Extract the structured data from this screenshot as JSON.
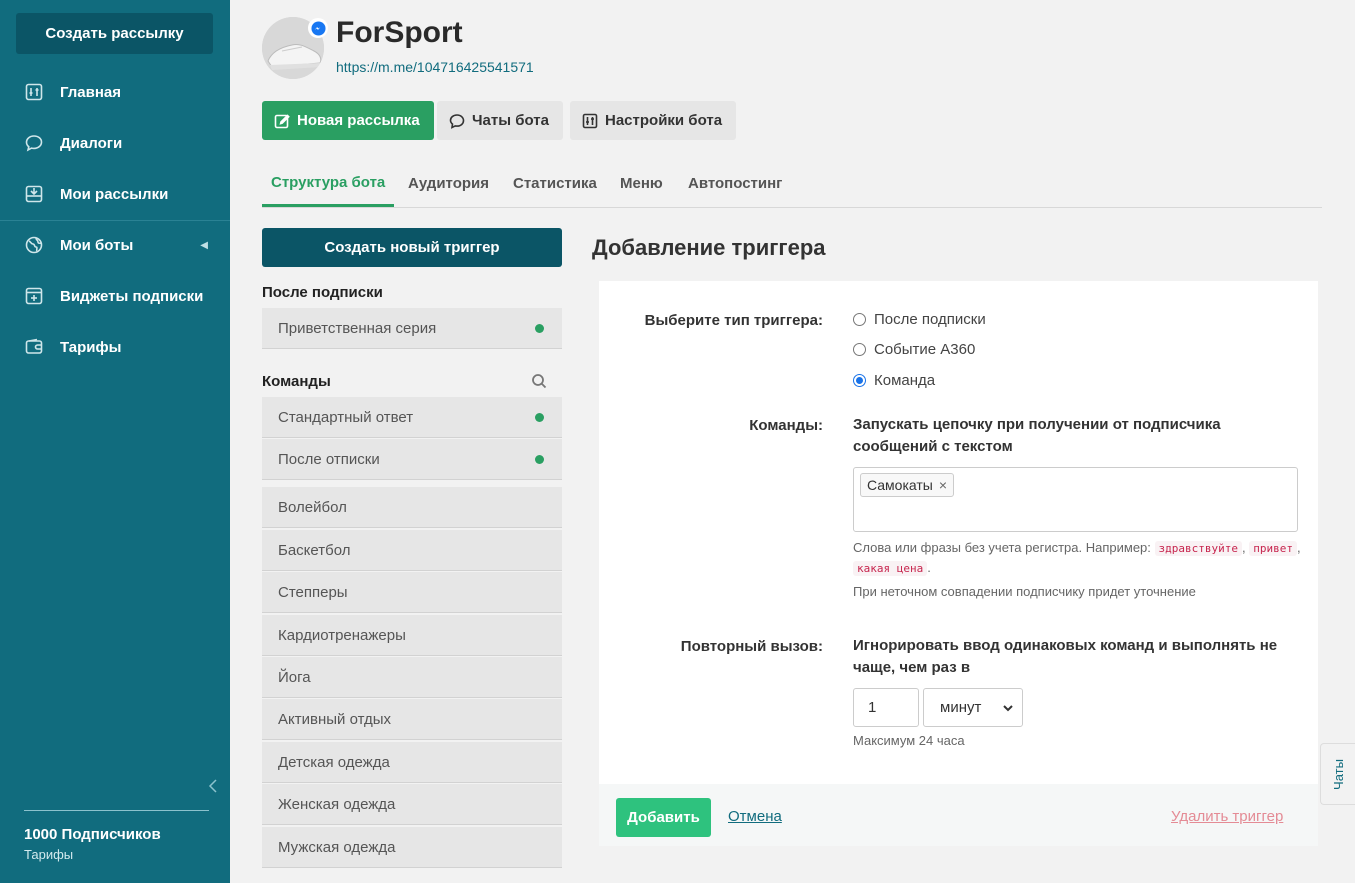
{
  "sidebar": {
    "create_button": "Создать рассылку",
    "items": [
      {
        "label": "Главная",
        "icon": "dashboard-icon"
      },
      {
        "label": "Диалоги",
        "icon": "chat-icon"
      },
      {
        "label": "Мои рассылки",
        "icon": "inbox-icon"
      },
      {
        "label": "Мои боты",
        "icon": "globe-icon"
      },
      {
        "label": "Виджеты подписки",
        "icon": "widget-icon"
      },
      {
        "label": "Тарифы",
        "icon": "wallet-icon"
      }
    ],
    "subscribers": "1000 Подписчиков",
    "tariffs_link": "Тарифы"
  },
  "header": {
    "title": "ForSport",
    "link": "https://m.me/104716425541571",
    "buttons": {
      "new_mailing": "Новая рассылка",
      "bot_chats": "Чаты бота",
      "bot_settings": "Настройки бота"
    }
  },
  "tabs": [
    "Структура бота",
    "Аудитория",
    "Статистика",
    "Меню",
    "Автопостинг"
  ],
  "left": {
    "create_trigger": "Создать новый триггер",
    "after_subscribe_label": "После подписки",
    "after_subscribe_items": [
      "Приветственная серия"
    ],
    "commands_label": "Команды",
    "command_items_active": [
      "Стандартный ответ",
      "После отписки"
    ],
    "command_items": [
      "Волейбол",
      "Баскетбол",
      "Степперы",
      "Кардиотренажеры",
      "Йога",
      "Активный отдых",
      "Детская одежда",
      "Женская одежда",
      "Мужская одежда"
    ]
  },
  "form": {
    "title": "Добавление триггера",
    "trigger_type_label": "Выберите тип триггера:",
    "trigger_types": [
      "После подписки",
      "Событие A360",
      "Команда"
    ],
    "selected_type": "Команда",
    "commands_label": "Команды:",
    "commands_desc": "Запускать цепочку при получении от подписчика сообщений с текстом",
    "tags": [
      "Самокаты"
    ],
    "hint_prefix": "Слова или фразы без учета регистра. Например:",
    "hint_examples": [
      "здравствуйте",
      "привет",
      "какая цена"
    ],
    "hint2": "При неточном совпадении подписчику придет уточнение",
    "repeat_label": "Повторный вызов:",
    "repeat_desc": "Игнорировать ввод одинаковых команд и выполнять не чаще, чем раз в",
    "repeat_value": "1",
    "repeat_unit": "минут",
    "max_hint": "Максимум 24 часа",
    "add_button": "Добавить",
    "cancel": "Отмена",
    "delete": "Удалить триггер"
  },
  "chats_tab": "Чаты"
}
